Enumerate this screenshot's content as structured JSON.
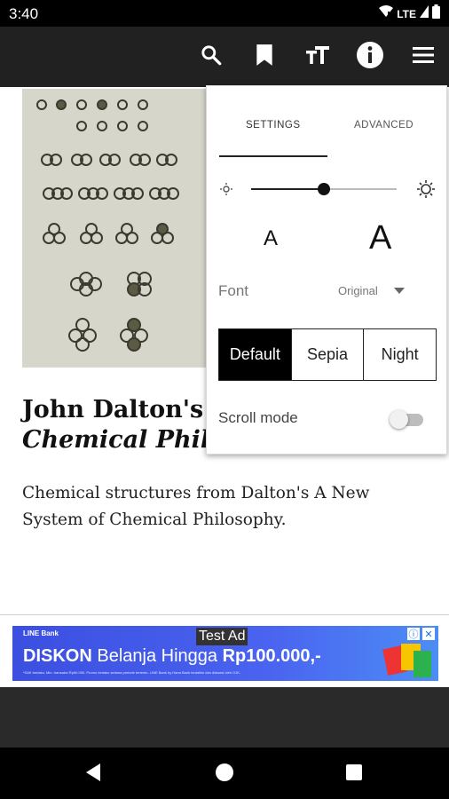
{
  "status_bar": {
    "time": "3:40",
    "network": "LTE"
  },
  "toolbar": {
    "icons": [
      "search-icon",
      "bookmark-icon",
      "text-size-icon",
      "info-icon",
      "menu-icon"
    ]
  },
  "article": {
    "title_line1": "John Dalton's A New System of",
    "title_line2": "Chemical Philosophy",
    "caption": "Chemical structures from Dalton's A New System of Chemical Philosophy."
  },
  "settings": {
    "tabs": [
      "SETTINGS",
      "ADVANCED"
    ],
    "active_tab": "SETTINGS",
    "brightness_level": 0.5,
    "font_small_label": "A",
    "font_large_label": "A",
    "font_label": "Font",
    "font_value": "Original",
    "themes": [
      "Default",
      "Sepia",
      "Night"
    ],
    "active_theme": "Default",
    "scroll_mode_label": "Scroll mode",
    "scroll_mode_on": false
  },
  "ad": {
    "label": "Test Ad",
    "brand": "LINE Bank",
    "headline_bold": "DISKON",
    "headline_mid": " Belanja Hingga ",
    "headline_amount": "Rp100.000,-",
    "fine_print": "*S&K berlaku. Min. transaksi Rp50.000. Promo berlaku selama periode tertentu. LINE Bank by Hana Bank terdaftar dan diawasi oleh OJK."
  },
  "colors": {
    "toolbar": "#212121",
    "ad_blue": "#4a63f0",
    "active_theme_bg": "#000000"
  }
}
